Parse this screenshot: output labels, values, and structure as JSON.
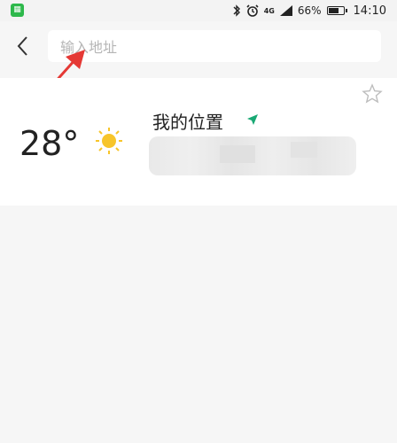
{
  "status_bar": {
    "battery_percent": "66%",
    "time": "14:10",
    "network": "4G",
    "app_icon": "app-notification-icon"
  },
  "header": {
    "back_icon": "back-icon",
    "search_placeholder": "输入地址",
    "search_value": ""
  },
  "location_card": {
    "temperature": "28°",
    "weather_icon": "sun-icon",
    "title": "我的位置",
    "location_icon": "navigation-arrow-icon",
    "star_icon": "star-icon"
  },
  "annotation": {
    "arrow_color": "#e53935"
  },
  "colors": {
    "location_arrow": "#19a974",
    "sun": "#f7c52a"
  }
}
